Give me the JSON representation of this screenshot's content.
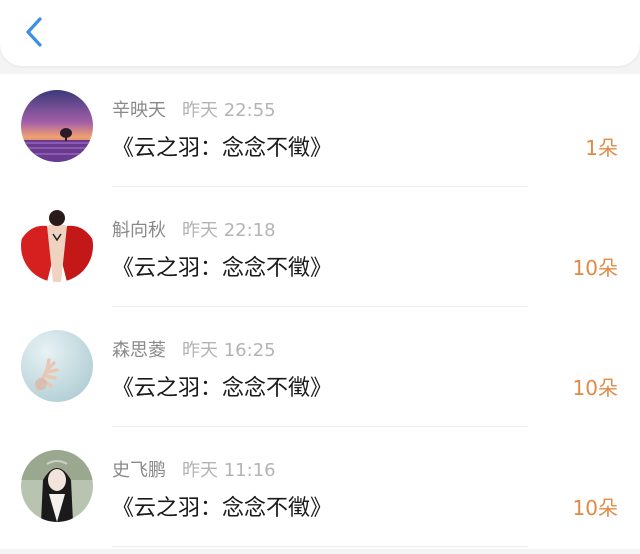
{
  "header": {
    "back_icon": "chevron-left-icon",
    "accent_color": "#3a8fe8"
  },
  "records": [
    {
      "name": "辛映天",
      "time": "昨天 22:55",
      "title": "《云之羽：念念不徵》",
      "count": "1朵"
    },
    {
      "name": "斛向秋",
      "time": "昨天 22:18",
      "title": "《云之羽：念念不徵》",
      "count": "10朵"
    },
    {
      "name": "森思菱",
      "time": "昨天 16:25",
      "title": "《云之羽：念念不徵》",
      "count": "10朵"
    },
    {
      "name": "史飞鹏",
      "time": "昨天 11:16",
      "title": "《云之羽：念念不徵》",
      "count": "10朵"
    }
  ],
  "colors": {
    "count_text": "#e08a45",
    "name_text": "#8a8a8a",
    "time_text": "#b4b4b4",
    "title_text": "#1a1a1a"
  }
}
